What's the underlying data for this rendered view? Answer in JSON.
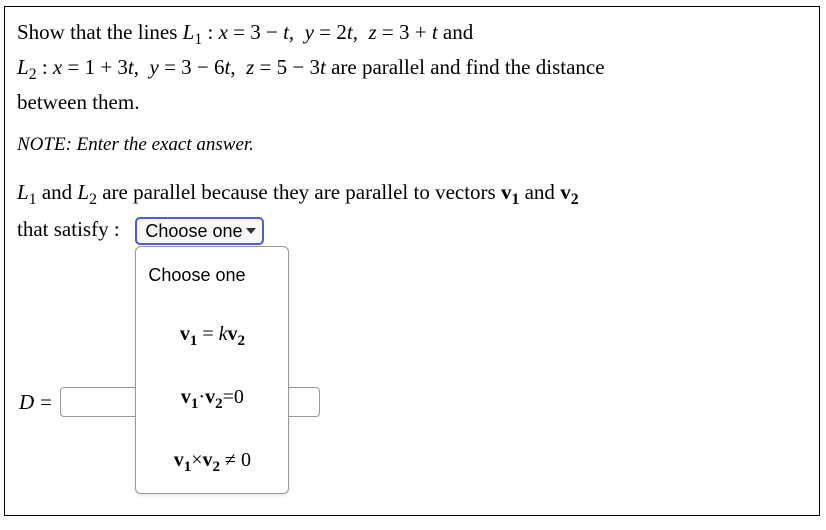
{
  "problem": {
    "line1": "Show that the lines L₁ : x = 3 − t,  y = 2t,  z = 3 + t and",
    "line2": "L₂ : x = 1 + 3t,  y = 3 − 6t,  z = 5 − 3t are parallel and find the distance",
    "line3": "between them."
  },
  "note": "NOTE: Enter the exact answer.",
  "explanation": {
    "part1_a": "L",
    "part1_b": " and L",
    "part1_c": " are parallel because they are parallel to vectors ",
    "v1": "v",
    "sub1": "1",
    "and": " and ",
    "v2": "v",
    "sub2": "2",
    "part2": "that satisfy :"
  },
  "dropdown": {
    "selected": "Choose one",
    "items": {
      "header": "Choose one",
      "opt1_v1": "v",
      "opt1_s1": "1",
      "opt1_eq": " = ",
      "opt1_k": "k",
      "opt1_v2": "v",
      "opt1_s2": "2",
      "opt2_v1": "v",
      "opt2_s1": "1",
      "opt2_dot": "·",
      "opt2_v2": "v",
      "opt2_s2": "2",
      "opt2_eq": "=0",
      "opt3_v1": "v",
      "opt3_s1": "1",
      "opt3_x": "×",
      "opt3_v2": "v",
      "opt3_s2": "2",
      "opt3_ne": " ≠ 0"
    }
  },
  "answer": {
    "D": "D",
    "eq": "=",
    "value": ""
  }
}
